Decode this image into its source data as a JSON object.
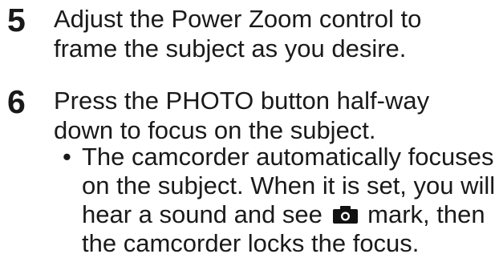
{
  "steps": [
    {
      "number": "5",
      "lines": [
        "Adjust the Power Zoom control to",
        "frame the subject as you desire."
      ]
    },
    {
      "number": "6",
      "lines": [
        "Press the PHOTO button half-way",
        "down to focus on the subject."
      ]
    }
  ],
  "bullet": {
    "marker": "•",
    "lines": [
      "The camcorder automatically focuses",
      "on the subject. When it is set, you will"
    ],
    "line3_before_icon": "hear a sound and see",
    "line3_after_icon": "mark, then",
    "line4": "the camcorder locks the focus.",
    "icon": "camera-icon"
  }
}
